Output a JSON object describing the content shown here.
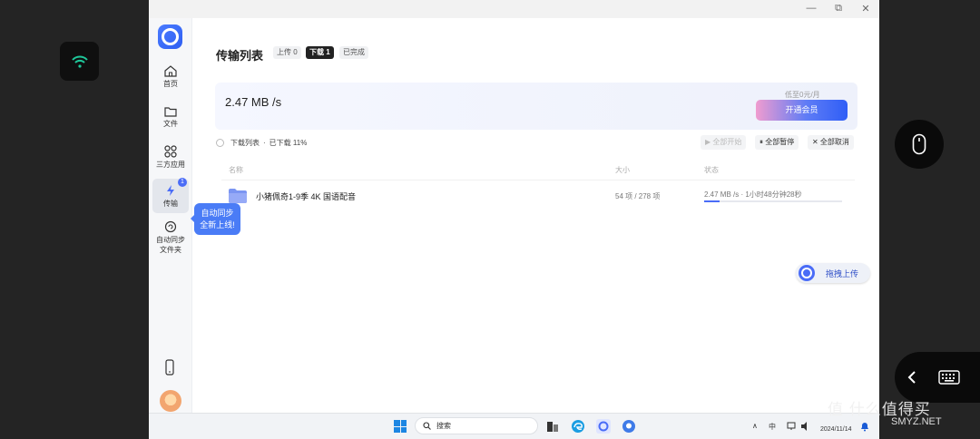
{
  "window": {
    "controls": {
      "minimize": "—",
      "restore": "⧉",
      "close": "✕"
    }
  },
  "sidebar": {
    "items": [
      {
        "label": "首页",
        "icon": "home-icon"
      },
      {
        "label": "文件",
        "icon": "folder-icon"
      },
      {
        "label": "三方应用",
        "icon": "apps-icon"
      },
      {
        "label": "传输",
        "icon": "transfer-icon",
        "badge": "1",
        "active": true
      },
      {
        "label": "自动同步",
        "label2": "文件夹",
        "icon": "sync-icon"
      }
    ],
    "tooltip": {
      "line1": "自动同步",
      "line2": "全新上线!"
    }
  },
  "main": {
    "title": "传输列表",
    "tabs": [
      {
        "label": "上传 0"
      },
      {
        "label": "下载 1",
        "active": true
      },
      {
        "label": "已完成"
      }
    ],
    "speed": "2.47 MB /s",
    "promo": "低至0元/月",
    "vip_button": "开通会员",
    "list_title": "下载列表",
    "list_dot": "·",
    "list_progress": "已下载 11%",
    "actions": {
      "start_all": "▶ 全部开始",
      "pause_all": "⏸ 全部暂停",
      "cancel_all": "✕ 全部取消"
    },
    "columns": {
      "name": "名称",
      "size": "大小",
      "status": "状态"
    },
    "rows": [
      {
        "name": "小猪佩奇1-9季 4K 国语配音",
        "count": "54 项 / 278 项",
        "status": "2.47 MB /s · 1小时48分钟28秒",
        "progress": 0.11
      }
    ],
    "drag_upload": "拖拽上传"
  },
  "taskbar": {
    "search": "搜索",
    "tray_ime": "中",
    "date": "2024/11/14"
  },
  "overlay": {
    "watermark": "值 什么值得买",
    "watermark_url": "SMYZ.NET"
  },
  "colors": {
    "accent": "#4a6cf7",
    "vip_gradient_start": "#f09ccf",
    "vip_gradient_end": "#2f5ef6",
    "wifi": "#1fc79a"
  }
}
